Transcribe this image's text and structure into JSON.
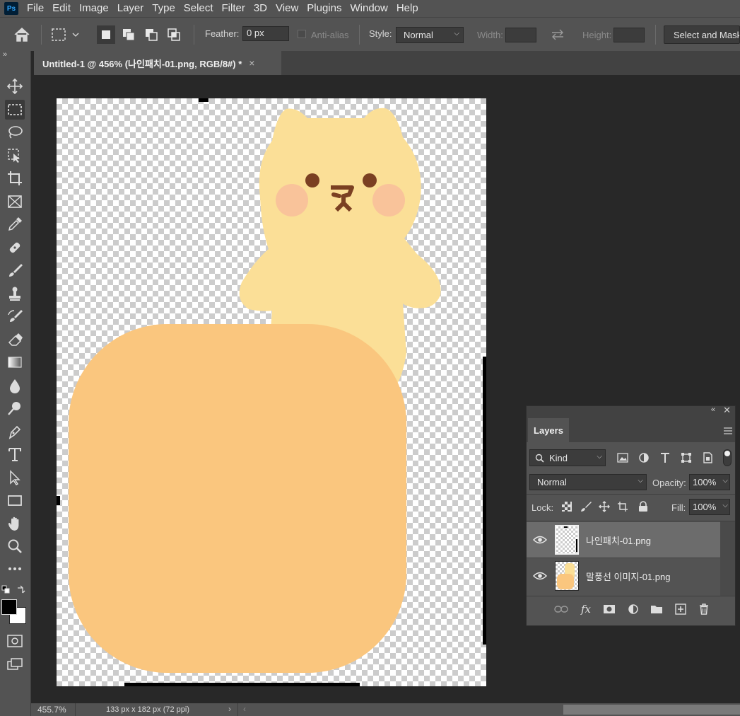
{
  "app": {
    "logo": "Ps"
  },
  "menu": [
    "File",
    "Edit",
    "Image",
    "Layer",
    "Type",
    "Select",
    "Filter",
    "3D",
    "View",
    "Plugins",
    "Window",
    "Help"
  ],
  "options": {
    "feather_label": "Feather:",
    "feather_value": "0 px",
    "antialias_label": "Anti-alias",
    "style_label": "Style:",
    "style_value": "Normal",
    "width_label": "Width:",
    "height_label": "Height:",
    "select_mask_label": "Select and Mask..."
  },
  "document": {
    "tab_title": "Untitled-1 @ 456% (나인패치-01.png, RGB/8#) *",
    "close": "×"
  },
  "status": {
    "zoom": "455.7%",
    "info": "133 px x 182 px (72 ppi)"
  },
  "toolbar": {
    "expand": "»"
  },
  "layers": {
    "tab_label": "Layers",
    "kind_label": "Kind",
    "blend_mode": "Normal",
    "opacity_label": "Opacity:",
    "opacity_value": "100%",
    "lock_label": "Lock:",
    "fill_label": "Fill:",
    "fill_value": "100%",
    "items": [
      {
        "name": "나인패치-01.png",
        "selected": true
      },
      {
        "name": "말풍선 이미지-01.png",
        "selected": false
      }
    ]
  },
  "colors": {
    "bear": "#fbdf97",
    "bubble": "#fac67e",
    "cheek": "#f9c39a",
    "eyes": "#7b4022",
    "ui_dark": "#535353"
  }
}
